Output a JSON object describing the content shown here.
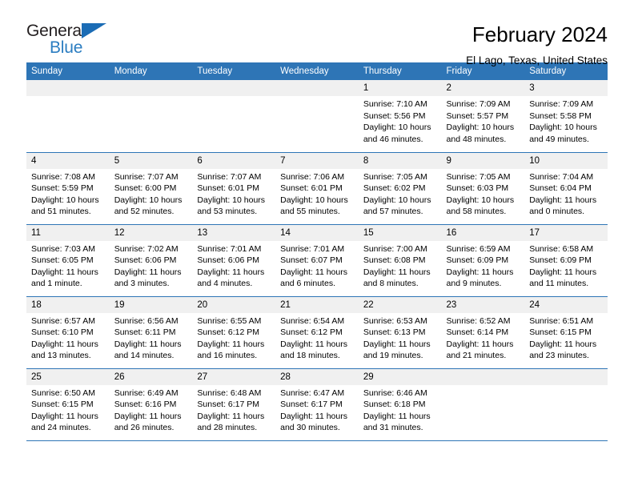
{
  "brand": {
    "name_top": "General",
    "name_bottom": "Blue",
    "triangle_color": "#1b6cb5",
    "text_color": "#231f20",
    "blue_color": "#2b7dc1",
    "logo_icon": "triangle-flag-icon"
  },
  "header": {
    "month_title": "February 2024",
    "location": "El Lago, Texas, United States"
  },
  "theme": {
    "header_row_bg": "#2e75b6",
    "header_row_text": "#ffffff",
    "daynum_bg": "#f0f0f0",
    "cell_bg": "#ffffff",
    "row_divider": "#2e75b6"
  },
  "calendar": {
    "weekday_headers": [
      "Sunday",
      "Monday",
      "Tuesday",
      "Wednesday",
      "Thursday",
      "Friday",
      "Saturday"
    ],
    "weeks": [
      [
        {
          "day": "",
          "lines": []
        },
        {
          "day": "",
          "lines": []
        },
        {
          "day": "",
          "lines": []
        },
        {
          "day": "",
          "lines": []
        },
        {
          "day": "1",
          "lines": [
            "Sunrise: 7:10 AM",
            "Sunset: 5:56 PM",
            "Daylight: 10 hours",
            "and 46 minutes."
          ]
        },
        {
          "day": "2",
          "lines": [
            "Sunrise: 7:09 AM",
            "Sunset: 5:57 PM",
            "Daylight: 10 hours",
            "and 48 minutes."
          ]
        },
        {
          "day": "3",
          "lines": [
            "Sunrise: 7:09 AM",
            "Sunset: 5:58 PM",
            "Daylight: 10 hours",
            "and 49 minutes."
          ]
        }
      ],
      [
        {
          "day": "4",
          "lines": [
            "Sunrise: 7:08 AM",
            "Sunset: 5:59 PM",
            "Daylight: 10 hours",
            "and 51 minutes."
          ]
        },
        {
          "day": "5",
          "lines": [
            "Sunrise: 7:07 AM",
            "Sunset: 6:00 PM",
            "Daylight: 10 hours",
            "and 52 minutes."
          ]
        },
        {
          "day": "6",
          "lines": [
            "Sunrise: 7:07 AM",
            "Sunset: 6:01 PM",
            "Daylight: 10 hours",
            "and 53 minutes."
          ]
        },
        {
          "day": "7",
          "lines": [
            "Sunrise: 7:06 AM",
            "Sunset: 6:01 PM",
            "Daylight: 10 hours",
            "and 55 minutes."
          ]
        },
        {
          "day": "8",
          "lines": [
            "Sunrise: 7:05 AM",
            "Sunset: 6:02 PM",
            "Daylight: 10 hours",
            "and 57 minutes."
          ]
        },
        {
          "day": "9",
          "lines": [
            "Sunrise: 7:05 AM",
            "Sunset: 6:03 PM",
            "Daylight: 10 hours",
            "and 58 minutes."
          ]
        },
        {
          "day": "10",
          "lines": [
            "Sunrise: 7:04 AM",
            "Sunset: 6:04 PM",
            "Daylight: 11 hours",
            "and 0 minutes."
          ]
        }
      ],
      [
        {
          "day": "11",
          "lines": [
            "Sunrise: 7:03 AM",
            "Sunset: 6:05 PM",
            "Daylight: 11 hours",
            "and 1 minute."
          ]
        },
        {
          "day": "12",
          "lines": [
            "Sunrise: 7:02 AM",
            "Sunset: 6:06 PM",
            "Daylight: 11 hours",
            "and 3 minutes."
          ]
        },
        {
          "day": "13",
          "lines": [
            "Sunrise: 7:01 AM",
            "Sunset: 6:06 PM",
            "Daylight: 11 hours",
            "and 4 minutes."
          ]
        },
        {
          "day": "14",
          "lines": [
            "Sunrise: 7:01 AM",
            "Sunset: 6:07 PM",
            "Daylight: 11 hours",
            "and 6 minutes."
          ]
        },
        {
          "day": "15",
          "lines": [
            "Sunrise: 7:00 AM",
            "Sunset: 6:08 PM",
            "Daylight: 11 hours",
            "and 8 minutes."
          ]
        },
        {
          "day": "16",
          "lines": [
            "Sunrise: 6:59 AM",
            "Sunset: 6:09 PM",
            "Daylight: 11 hours",
            "and 9 minutes."
          ]
        },
        {
          "day": "17",
          "lines": [
            "Sunrise: 6:58 AM",
            "Sunset: 6:09 PM",
            "Daylight: 11 hours",
            "and 11 minutes."
          ]
        }
      ],
      [
        {
          "day": "18",
          "lines": [
            "Sunrise: 6:57 AM",
            "Sunset: 6:10 PM",
            "Daylight: 11 hours",
            "and 13 minutes."
          ]
        },
        {
          "day": "19",
          "lines": [
            "Sunrise: 6:56 AM",
            "Sunset: 6:11 PM",
            "Daylight: 11 hours",
            "and 14 minutes."
          ]
        },
        {
          "day": "20",
          "lines": [
            "Sunrise: 6:55 AM",
            "Sunset: 6:12 PM",
            "Daylight: 11 hours",
            "and 16 minutes."
          ]
        },
        {
          "day": "21",
          "lines": [
            "Sunrise: 6:54 AM",
            "Sunset: 6:12 PM",
            "Daylight: 11 hours",
            "and 18 minutes."
          ]
        },
        {
          "day": "22",
          "lines": [
            "Sunrise: 6:53 AM",
            "Sunset: 6:13 PM",
            "Daylight: 11 hours",
            "and 19 minutes."
          ]
        },
        {
          "day": "23",
          "lines": [
            "Sunrise: 6:52 AM",
            "Sunset: 6:14 PM",
            "Daylight: 11 hours",
            "and 21 minutes."
          ]
        },
        {
          "day": "24",
          "lines": [
            "Sunrise: 6:51 AM",
            "Sunset: 6:15 PM",
            "Daylight: 11 hours",
            "and 23 minutes."
          ]
        }
      ],
      [
        {
          "day": "25",
          "lines": [
            "Sunrise: 6:50 AM",
            "Sunset: 6:15 PM",
            "Daylight: 11 hours",
            "and 24 minutes."
          ]
        },
        {
          "day": "26",
          "lines": [
            "Sunrise: 6:49 AM",
            "Sunset: 6:16 PM",
            "Daylight: 11 hours",
            "and 26 minutes."
          ]
        },
        {
          "day": "27",
          "lines": [
            "Sunrise: 6:48 AM",
            "Sunset: 6:17 PM",
            "Daylight: 11 hours",
            "and 28 minutes."
          ]
        },
        {
          "day": "28",
          "lines": [
            "Sunrise: 6:47 AM",
            "Sunset: 6:17 PM",
            "Daylight: 11 hours",
            "and 30 minutes."
          ]
        },
        {
          "day": "29",
          "lines": [
            "Sunrise: 6:46 AM",
            "Sunset: 6:18 PM",
            "Daylight: 11 hours",
            "and 31 minutes."
          ]
        },
        {
          "day": "",
          "lines": []
        },
        {
          "day": "",
          "lines": []
        }
      ]
    ]
  }
}
